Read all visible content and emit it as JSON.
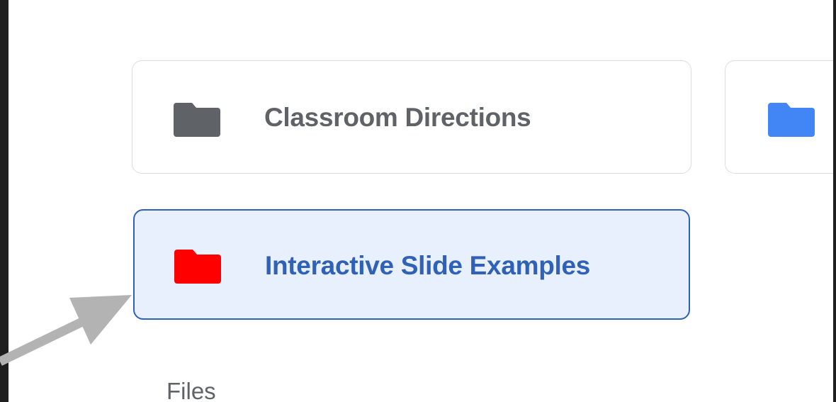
{
  "folders": [
    {
      "label": "Classroom Directions",
      "color": "#5f6368",
      "icon": "folder-icon"
    },
    {
      "label": "",
      "color": "#4285f4",
      "icon": "folder-icon"
    },
    {
      "label": "Interactive Slide Examples",
      "color": "#ff0000",
      "icon": "folder-icon",
      "selected": true
    }
  ],
  "sections": {
    "files_heading": "Files"
  },
  "colors": {
    "selection_background": "#e8f0fe",
    "selection_border": "#2f62b7",
    "annotation_arrow": "#b3b3b3"
  }
}
